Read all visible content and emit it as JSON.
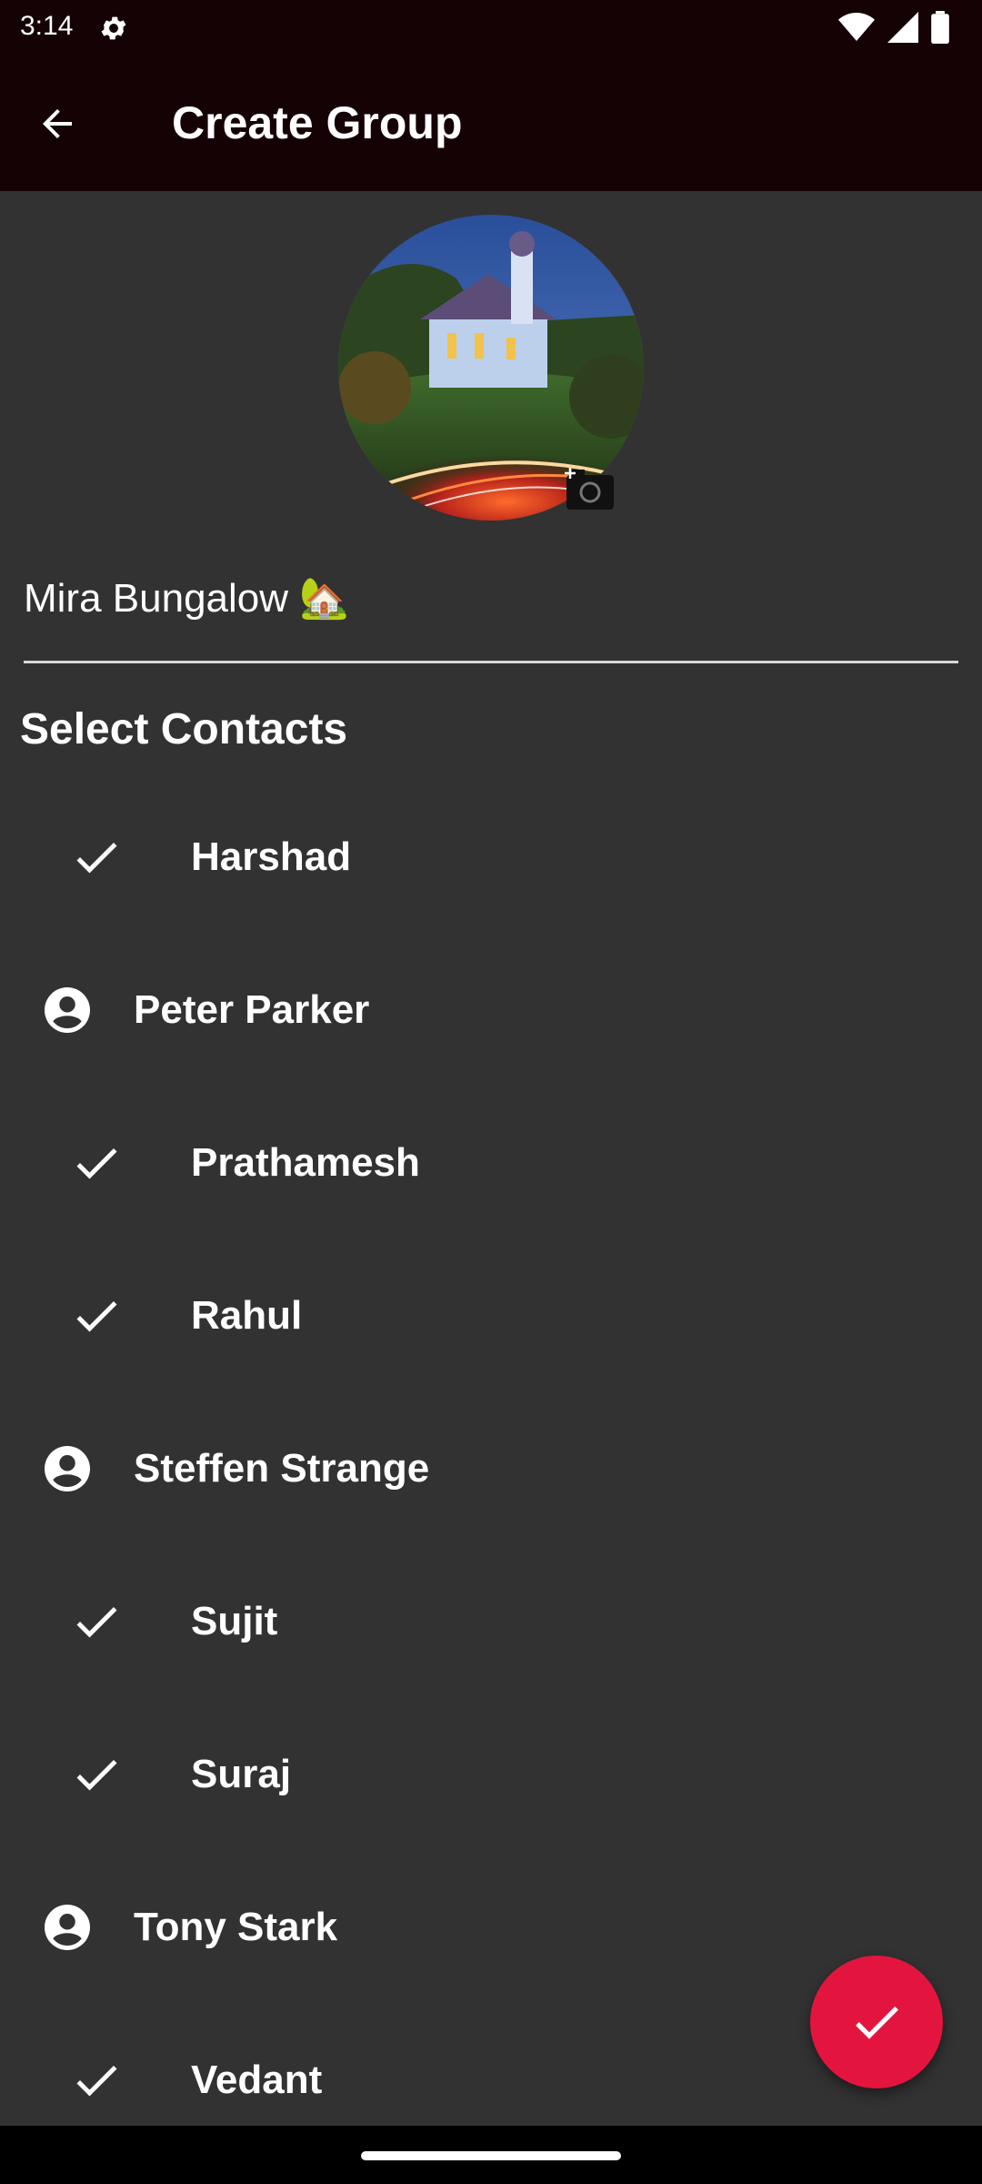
{
  "status_bar": {
    "time": "3:14",
    "icons": [
      "gear-icon",
      "wifi-icon",
      "signal-icon",
      "battery-icon"
    ]
  },
  "app_bar": {
    "title": "Create Group",
    "back_icon": "arrow-back-icon"
  },
  "group": {
    "avatar_icon": "camera-icon",
    "name": "Mira Bungalow 🏡"
  },
  "contacts_section": {
    "title": "Select Contacts",
    "items": [
      {
        "name": "Harshad",
        "selected": true
      },
      {
        "name": "Peter Parker",
        "selected": false
      },
      {
        "name": "Prathamesh",
        "selected": true
      },
      {
        "name": "Rahul",
        "selected": true
      },
      {
        "name": "Steffen Strange",
        "selected": false
      },
      {
        "name": "Sujit",
        "selected": true
      },
      {
        "name": "Suraj",
        "selected": true
      },
      {
        "name": "Tony Stark",
        "selected": false
      },
      {
        "name": "Vedant",
        "selected": true
      }
    ]
  },
  "fab": {
    "icon": "check-icon"
  },
  "colors": {
    "app_bar": "#150205",
    "background": "#323232",
    "accent": "#e3153e"
  }
}
